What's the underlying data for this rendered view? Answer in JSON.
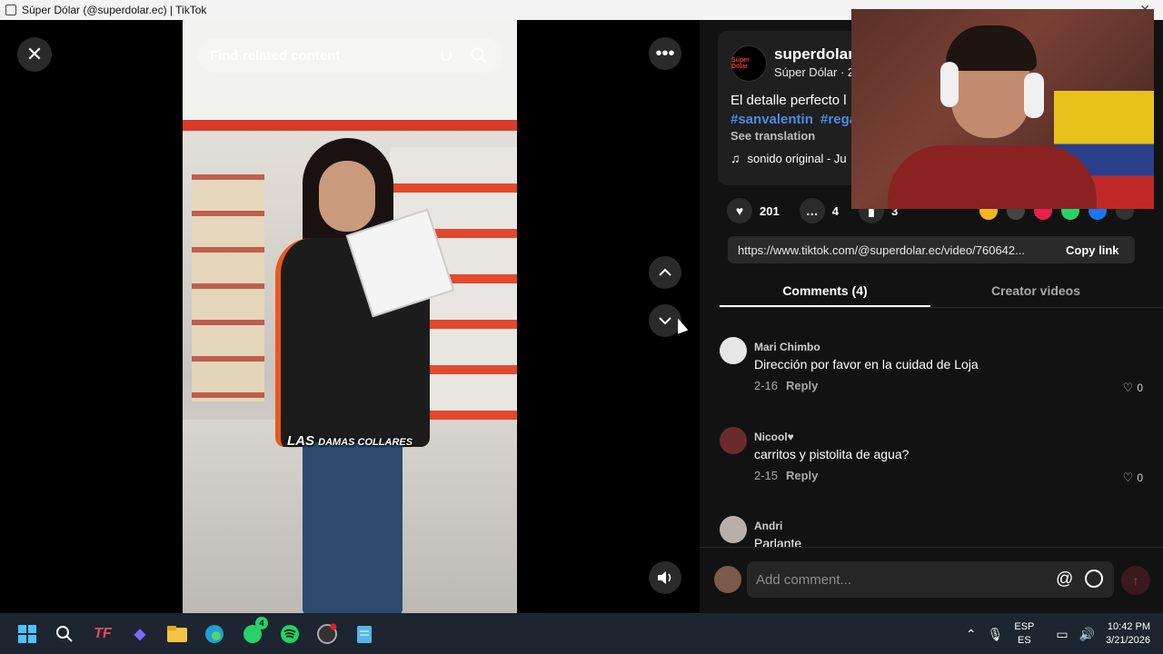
{
  "window": {
    "title": "Súper Dólar (@superdolar.ec) | TikTok"
  },
  "viewer": {
    "search_placeholder": "Find related content",
    "video_caption_big": "LAS",
    "video_caption_small": "DAMAS COLLARES"
  },
  "post": {
    "author_name": "superdolar",
    "author_sub": "Súper Dólar · 2",
    "avatar_text": "Súper Dólar",
    "description": "El detalle perfecto l",
    "hashtags": [
      "#sanvalentin",
      "#rega"
    ],
    "see_translation": "See translation",
    "music": "sonido original - Ju",
    "likes": "201",
    "comments": "4",
    "saves": "3",
    "link": "https://www.tiktok.com/@superdolar.ec/video/760642...",
    "copy_link": "Copy link"
  },
  "tabs": [
    {
      "label": "Comments (4)",
      "active": true
    },
    {
      "label": "Creator videos",
      "active": false
    }
  ],
  "comments": [
    {
      "user": "Mari Chimbo",
      "text": "Dirección por favor en la cuidad de Loja",
      "date": "2-16",
      "reply": "Reply",
      "likes": "0",
      "avatar_color": "#e6e6e6"
    },
    {
      "user": "Nicool♥",
      "text": "carritos y pistolita de agua?",
      "date": "2-15",
      "reply": "Reply",
      "likes": "0",
      "avatar_color": "#6a2a2e"
    },
    {
      "user": "Andri",
      "text": "Parlante",
      "date": "",
      "reply": "",
      "likes": "",
      "avatar_color": "#b8b0a8"
    }
  ],
  "comment_bar": {
    "placeholder": "Add comment..."
  },
  "taskbar": {
    "lang_top": "ESP",
    "lang_bottom": "ES",
    "time": "10:42 PM",
    "date": "3/21/2026",
    "whatsapp_badge": "4"
  },
  "colors": {
    "accent_hashtag": "#4c8ce4",
    "panel_bg": "#121212",
    "brand_red": "#e63e2a"
  }
}
